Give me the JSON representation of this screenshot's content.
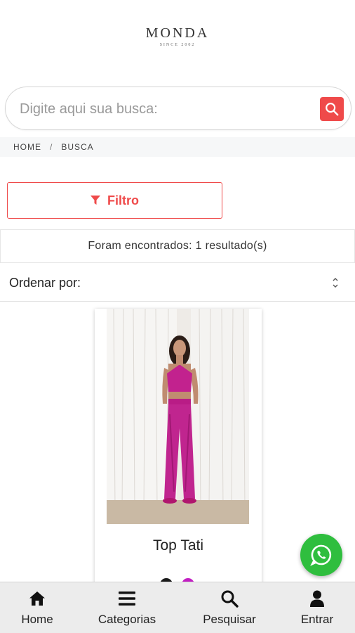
{
  "brand": {
    "name": "MONDA",
    "tagline": "SINCE 2002"
  },
  "search": {
    "placeholder": "Digite aqui sua busca:",
    "value": ""
  },
  "breadcrumb": {
    "items": [
      "HOME",
      "BUSCA"
    ],
    "separator": "/"
  },
  "filter": {
    "label": "Filtro"
  },
  "results": {
    "text": "Foram encontrados: 1 resultado(s)"
  },
  "sort": {
    "label": "Ordenar por:"
  },
  "products": [
    {
      "name": "Top Tati",
      "swatches": [
        "#1a1a1a",
        "#c21fc2"
      ]
    }
  ],
  "bottom_nav": {
    "items": [
      {
        "label": "Home",
        "icon": "home-icon"
      },
      {
        "label": "Categorias",
        "icon": "menu-icon"
      },
      {
        "label": "Pesquisar",
        "icon": "search-icon"
      },
      {
        "label": "Entrar",
        "icon": "user-icon"
      }
    ]
  },
  "colors": {
    "accent": "#ef4a4a",
    "whatsapp": "#2fbe3e",
    "nav_bg": "#ececec"
  }
}
